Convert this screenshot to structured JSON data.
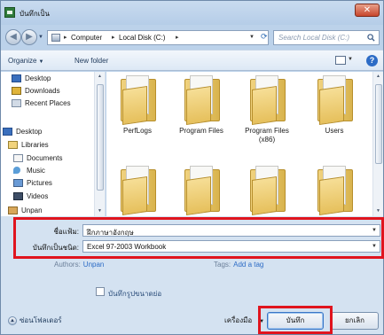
{
  "window": {
    "title": "บันทึกเป็น",
    "close_symbol": "✕"
  },
  "address": {
    "nav_back_symbol": "◀",
    "nav_forward_symbol": "▶",
    "crumbs": [
      "Computer",
      "Local Disk (C:)"
    ],
    "separator": "▸",
    "search_placeholder": "Search Local Disk (C:)"
  },
  "toolbar": {
    "organize_label": "Organize",
    "new_folder_label": "New folder",
    "help_symbol": "?"
  },
  "nav_pane": {
    "items": [
      {
        "label": "Desktop",
        "icon": "desktop-icon"
      },
      {
        "label": "Downloads",
        "icon": "downloads-icon"
      },
      {
        "label": "Recent Places",
        "icon": "recent-places-icon"
      },
      {
        "label": "Desktop",
        "icon": "desktop-icon"
      },
      {
        "label": "Libraries",
        "icon": "libraries-icon"
      },
      {
        "label": "Documents",
        "icon": "documents-icon"
      },
      {
        "label": "Music",
        "icon": "music-icon"
      },
      {
        "label": "Pictures",
        "icon": "pictures-icon"
      },
      {
        "label": "Videos",
        "icon": "videos-icon"
      },
      {
        "label": "Unpan",
        "icon": "user-folder-icon"
      }
    ]
  },
  "folders": [
    {
      "label": "PerfLogs"
    },
    {
      "label": "Program Files"
    },
    {
      "label": "Program Files\n(x86)"
    },
    {
      "label": "Users"
    },
    {
      "label": ""
    },
    {
      "label": ""
    },
    {
      "label": ""
    },
    {
      "label": ""
    }
  ],
  "form": {
    "filename_label": "ชื่อแฟ้ม:",
    "filename_value": "ฝึกภาษาอังกฤษ",
    "savetype_label": "บันทึกเป็นชนิด:",
    "savetype_value": "Excel 97-2003 Workbook",
    "authors_label": "Authors:",
    "authors_value": "Unpan",
    "tags_label": "Tags:",
    "tags_value": "Add a tag",
    "thumbnail_label": "บันทึกรูปขนาดย่อ",
    "hide_folders_label": "ซ่อนโฟลเดอร์",
    "tools_label": "เครื่องมือ",
    "save_label": "บันทึก",
    "cancel_label": "ยกเลิก"
  },
  "colors": {
    "highlight_box": "#e0141e",
    "accent": "#2d6cc6"
  }
}
